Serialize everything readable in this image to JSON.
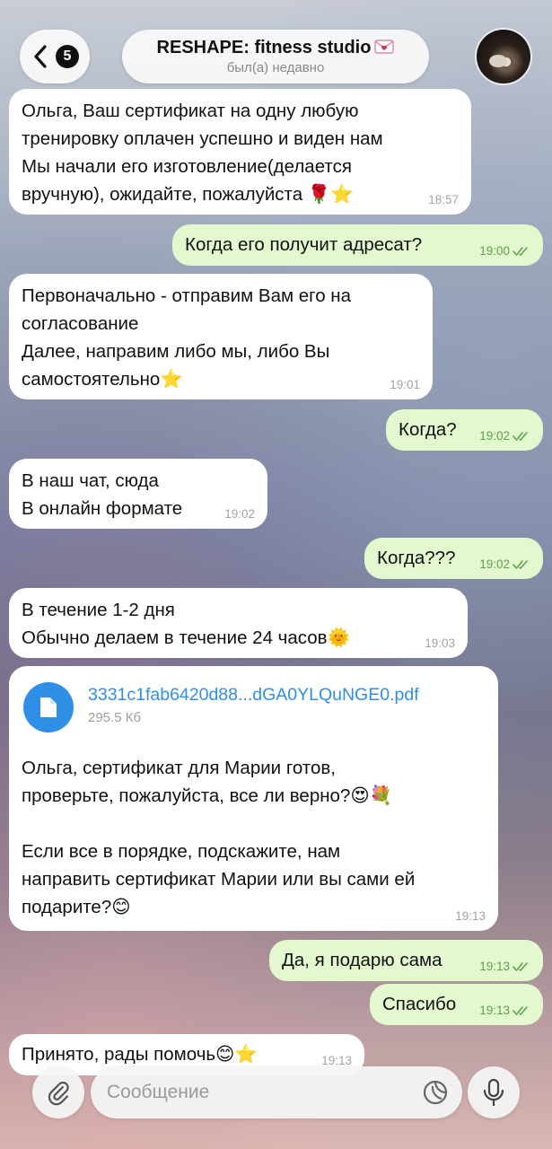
{
  "header": {
    "back_count": "5",
    "title": "RESHAPE: fitness studio",
    "status": "был(а) недавно"
  },
  "messages": [
    {
      "dir": "in",
      "lines": [
        "Ольга, Ваш сертификат на одну любую",
        "тренировку оплачен успешно и виден нам",
        "Мы начали его изготовление(делается",
        "вручную), ожидайте, пожалуйста 🌹⭐"
      ],
      "time": "18:57"
    },
    {
      "dir": "out",
      "lines": [
        "Когда его получит адресат?"
      ],
      "time": "19:00"
    },
    {
      "dir": "in",
      "lines": [
        "Первоначально - отправим Вам его на",
        "согласование",
        "Далее, направим либо мы, либо Вы",
        "самостоятельно⭐"
      ],
      "time": "19:01"
    },
    {
      "dir": "out",
      "lines": [
        "Когда?"
      ],
      "time": "19:02"
    },
    {
      "dir": "in",
      "lines": [
        "В наш чат, сюда",
        "В онлайн формате"
      ],
      "time": "19:02"
    },
    {
      "dir": "out",
      "lines": [
        "Когда???"
      ],
      "time": "19:02"
    },
    {
      "dir": "in",
      "lines": [
        "В течение 1-2 дня",
        "Обычно делаем в течение 24 часов🌞"
      ],
      "time": "19:03"
    },
    {
      "dir": "in",
      "file": {
        "name": "3331c1fab6420d88...dGA0YLQuNGE0.pdf",
        "size": "295.5 Кб",
        "icon": "file-icon"
      },
      "lines": [
        "Ольга, сертификат для Марии готов,",
        "проверьте, пожалуйста, все ли верно?😍💐",
        "",
        "Если все в порядке, подскажите, нам",
        "направить сертификат Марии или вы сами ей",
        "подарите?😊"
      ],
      "time": "19:13"
    },
    {
      "dir": "out",
      "lines": [
        "Да, я подарю сама"
      ],
      "time": "19:13"
    },
    {
      "dir": "out",
      "lines": [
        "Спасибо"
      ],
      "time": "19:13"
    },
    {
      "dir": "in",
      "lines": [
        "Принято, рады помочь😊⭐"
      ],
      "time": "19:13"
    }
  ],
  "composer": {
    "placeholder": "Сообщение",
    "attach_icon": "paperclip-icon",
    "sticker_icon": "sticker-icon",
    "mic_icon": "microphone-icon"
  },
  "colors": {
    "incoming_bubble": "#ffffff",
    "outgoing_bubble": "#e3f8cf",
    "link": "#2f8fe6",
    "read_check": "#5fa04a"
  }
}
